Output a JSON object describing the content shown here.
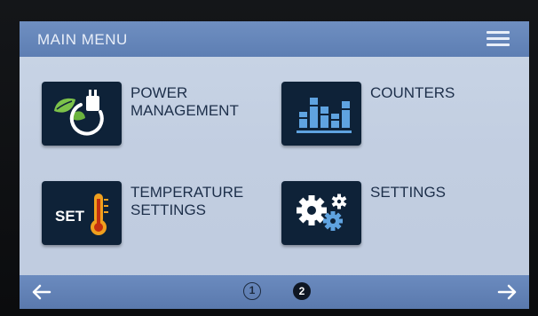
{
  "header": {
    "title": "MAIN MENU",
    "menu_icon": "hamburger-menu-icon"
  },
  "tiles": [
    {
      "label": "POWER\nMANAGEMENT",
      "icon": "leaf-plug-icon"
    },
    {
      "label": "COUNTERS",
      "icon": "bar-chart-icon"
    },
    {
      "label": "TEMPERATURE\nSETTINGS",
      "icon": "set-thermometer-icon",
      "icon_text": "SET"
    },
    {
      "label": "SETTINGS",
      "icon": "gears-icon"
    }
  ],
  "footer": {
    "prev_icon": "arrow-left-icon",
    "next_icon": "arrow-right-icon",
    "pages": [
      "1",
      "2"
    ],
    "current_page": "2"
  },
  "colors": {
    "header": "#6a8bbf",
    "background": "#c6d2e4",
    "tile": "#0e2238",
    "icon_accent": "#5fa3e0",
    "leaf_green": "#7cc24a",
    "thermometer_orange": "#f0a01e"
  }
}
